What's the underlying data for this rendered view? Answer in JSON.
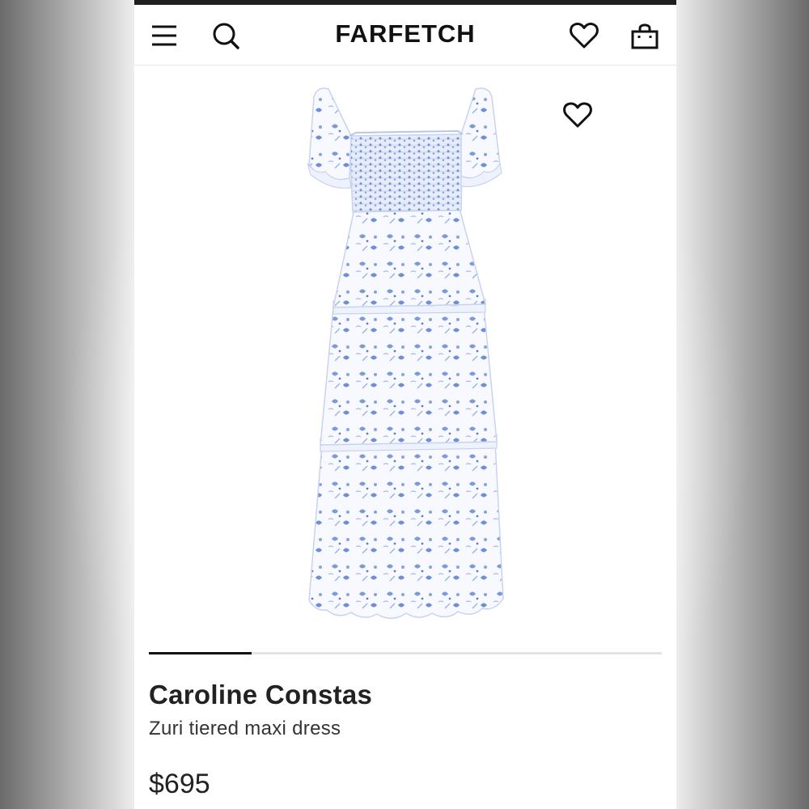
{
  "header": {
    "brand": "FARFETCH",
    "menu_icon": "hamburger-menu-icon",
    "search_icon": "search-icon",
    "wishlist_icon": "heart-outline-icon",
    "bag_icon": "shopping-bag-icon"
  },
  "product": {
    "designer": "Caroline Constas",
    "name": "Zuri tiered maxi dress",
    "price": "$695",
    "image_description_icon": "dress-image",
    "favorite_icon": "heart-outline-icon",
    "gallery_progress": 0.2,
    "fabric_color": "#ffffff",
    "print_color": "#6f93d6"
  }
}
